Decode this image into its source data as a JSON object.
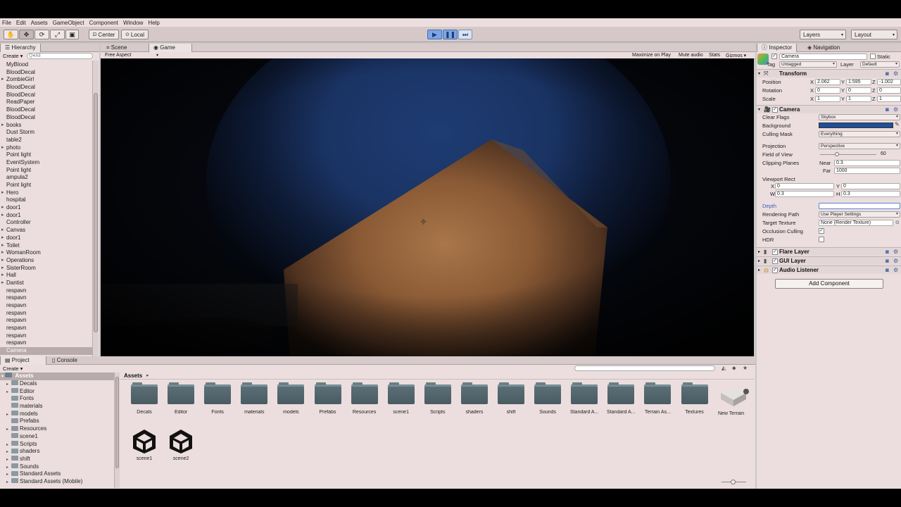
{
  "menu": [
    "File",
    "Edit",
    "Assets",
    "GameObject",
    "Component",
    "Window",
    "Help"
  ],
  "toolbar": {
    "pivot_label": "Center",
    "space_label": "Local",
    "layers_label": "Layers",
    "layout_label": "Layout"
  },
  "hierarchy": {
    "tab_label": "Hierarchy",
    "create_label": "Create",
    "search_placeholder": "Q▾All",
    "items": [
      {
        "label": "MyBlood",
        "arrow": false
      },
      {
        "label": "BloodDecal",
        "arrow": false
      },
      {
        "label": "ZombieGirl",
        "arrow": true
      },
      {
        "label": "BloodDecal",
        "arrow": false
      },
      {
        "label": "BloodDecal",
        "arrow": false
      },
      {
        "label": "ReadPaper",
        "arrow": false
      },
      {
        "label": "BloodDecal",
        "arrow": false
      },
      {
        "label": "BloodDecal",
        "arrow": false
      },
      {
        "label": "books",
        "arrow": true
      },
      {
        "label": "Dust Storm",
        "arrow": false
      },
      {
        "label": "table2",
        "arrow": false
      },
      {
        "label": "photo",
        "arrow": true
      },
      {
        "label": "Point light",
        "arrow": false
      },
      {
        "label": "EventSystem",
        "arrow": false
      },
      {
        "label": "Point light",
        "arrow": false
      },
      {
        "label": "ampula2",
        "arrow": false
      },
      {
        "label": "Point light",
        "arrow": false
      },
      {
        "label": "Hero",
        "arrow": true
      },
      {
        "label": "hospital",
        "arrow": false
      },
      {
        "label": "door1",
        "arrow": true
      },
      {
        "label": "door1",
        "arrow": true
      },
      {
        "label": "Controller",
        "arrow": false
      },
      {
        "label": "Canvas",
        "arrow": true
      },
      {
        "label": "door1",
        "arrow": true
      },
      {
        "label": "Toilet",
        "arrow": true
      },
      {
        "label": "WomanRoom",
        "arrow": true
      },
      {
        "label": "Operations",
        "arrow": true
      },
      {
        "label": "SisterRoom",
        "arrow": true
      },
      {
        "label": "Hall",
        "arrow": true
      },
      {
        "label": "Dantist",
        "arrow": true
      },
      {
        "label": "respavn",
        "arrow": false
      },
      {
        "label": "respavn",
        "arrow": false
      },
      {
        "label": "respavn",
        "arrow": false
      },
      {
        "label": "respavn",
        "arrow": false
      },
      {
        "label": "respavn",
        "arrow": false
      },
      {
        "label": "respavn",
        "arrow": false
      },
      {
        "label": "respavn",
        "arrow": false
      },
      {
        "label": "respavn",
        "arrow": false
      },
      {
        "label": "Camera",
        "arrow": false,
        "selected": true
      }
    ]
  },
  "scene_tabs": {
    "scene_label": "Scene",
    "game_label": "Game",
    "aspect_label": "Free Aspect",
    "maximize_label": "Maximize on Play",
    "mute_label": "Mute audio",
    "stats_label": "Stats",
    "gizmos_label": "Gizmos"
  },
  "inspector": {
    "tab_label": "Inspector",
    "nav_tab_label": "Navigation",
    "object_name": "Camera",
    "static_label": "Static",
    "tag_label": "Tag",
    "tag_value": "Untagged",
    "layer_label": "Layer",
    "layer_value": "Default",
    "transform": {
      "title": "Transform",
      "position_label": "Position",
      "rotation_label": "Rotation",
      "scale_label": "Scale",
      "position": [
        "2.062",
        "1.595",
        "-1.002"
      ],
      "rotation": [
        "0",
        "0",
        "0"
      ],
      "scale": [
        "1",
        "1",
        "1"
      ]
    },
    "camera": {
      "title": "Camera",
      "clear_flags_label": "Clear Flags",
      "clear_flags_value": "Skybox",
      "background_label": "Background",
      "background_color": "#1f4f9a",
      "culling_mask_label": "Culling Mask",
      "culling_mask_value": "Everything",
      "projection_label": "Projection",
      "projection_value": "Perspective",
      "fov_label": "Field of View",
      "fov_value": "60",
      "clipping_label": "Clipping Planes",
      "near_label": "Near",
      "near_value": "0.3",
      "far_label": "Far",
      "far_value": "1000",
      "viewport_label": "Viewport Rect",
      "vx_label": "X",
      "vx_value": "0",
      "vy_label": "Y",
      "vy_value": "0",
      "vw_label": "W",
      "vw_value": "0.3",
      "vh_label": "H",
      "vh_value": "0.3",
      "depth_label": "Depth",
      "depth_value": "",
      "render_path_label": "Rendering Path",
      "render_path_value": "Use Player Settings",
      "target_texture_label": "Target Texture",
      "target_texture_value": "None (Render Texture)",
      "occlusion_label": "Occlusion Culling",
      "hdr_label": "HDR"
    },
    "flare_layer": "Flare Layer",
    "gui_layer": "GUI Layer",
    "audio_listener": "Audio Listener",
    "add_component_label": "Add Component"
  },
  "project": {
    "tab_label": "Project",
    "console_tab_label": "Console",
    "create_label": "Create",
    "breadcrumb": "Assets",
    "tree_root": "Assets",
    "tree": [
      "Decals",
      "Editor",
      "Fonts",
      "materials",
      "models",
      "Prefabs",
      "Resources",
      "scene1",
      "Scripts",
      "shaders",
      "shift",
      "Sounds",
      "Standard Assets",
      "Standard Assets (Mobile)"
    ],
    "tree_has_arrow": [
      true,
      true,
      false,
      false,
      true,
      false,
      true,
      false,
      true,
      true,
      true,
      true,
      true,
      true
    ],
    "assets": [
      "Decals",
      "Editor",
      "Fonts",
      "materials",
      "models",
      "Prefabs",
      "Resources",
      "scene1",
      "Scripts",
      "shaders",
      "shift",
      "Sounds",
      "Standard A...",
      "Standard A...",
      "Terrain As...",
      "Textures",
      "New Terrain"
    ],
    "scenes": [
      "scene1",
      "scene2"
    ]
  }
}
